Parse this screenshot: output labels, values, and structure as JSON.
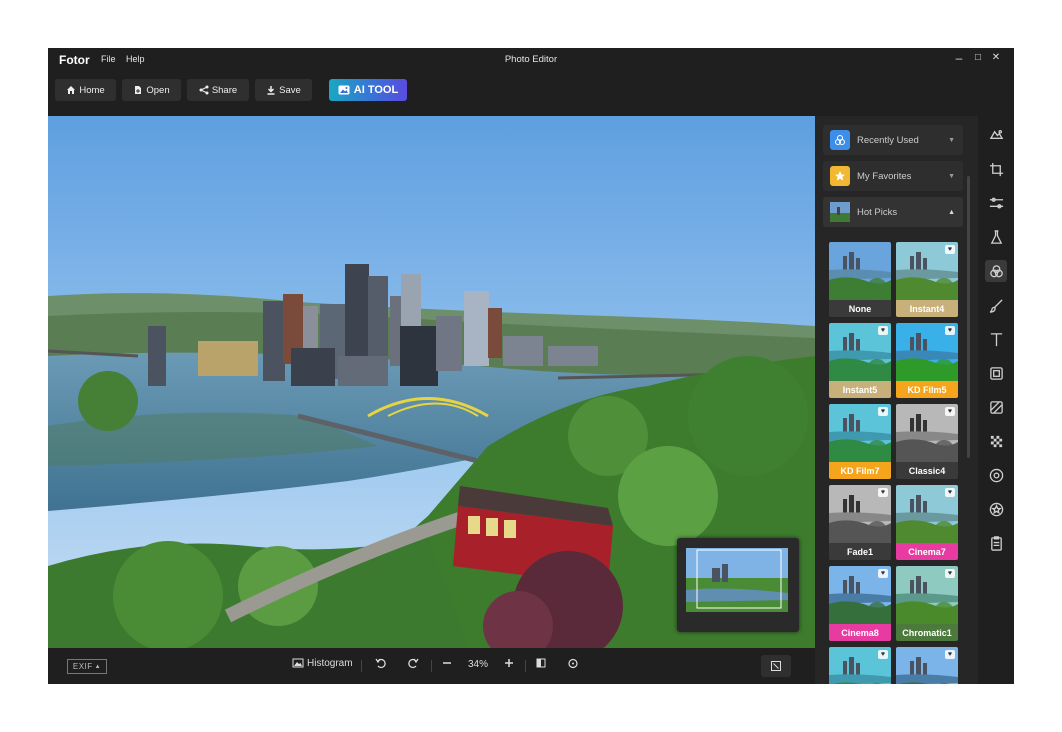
{
  "app": {
    "brand": "Fotor",
    "window_title": "Photo Editor"
  },
  "menu": [
    "File",
    "Help"
  ],
  "window_controls": {
    "minimize": "–",
    "maximize": "□",
    "close": "✕"
  },
  "toolbar": {
    "home_label": "Home",
    "open_label": "Open",
    "share_label": "Share",
    "save_label": "Save",
    "ai_label": "AI TOOL"
  },
  "bottombar": {
    "exif_label": "EXIF",
    "histogram_label": "Histogram",
    "zoom_level": "34%"
  },
  "panel": {
    "sections": [
      {
        "label": "Recently Used",
        "icon": "circles-icon",
        "color": "#3c8ee8",
        "expanded": false
      },
      {
        "label": "My Favorites",
        "icon": "star-icon",
        "color": "#f3b833",
        "expanded": false
      },
      {
        "label": "Hot Picks",
        "icon": "photo-icon",
        "color": "#555555",
        "expanded": true
      }
    ],
    "filters": [
      {
        "label": "None",
        "color": "#3a3a3a",
        "favorite": false
      },
      {
        "label": "Instant4",
        "color": "#c8b07a",
        "favorite": true
      },
      {
        "label": "Instant5",
        "color": "#c8b07a",
        "favorite": true
      },
      {
        "label": "KD Film5",
        "color": "#f4a51c",
        "favorite": true
      },
      {
        "label": "KD Film7",
        "color": "#f4a51c",
        "favorite": true
      },
      {
        "label": "Classic4",
        "color": "#3a3a3a",
        "favorite": true
      },
      {
        "label": "Fade1",
        "color": "#3a3a3a",
        "favorite": true
      },
      {
        "label": "Cinema7",
        "color": "#e83ba2",
        "favorite": true
      },
      {
        "label": "Cinema8",
        "color": "#e83ba2",
        "favorite": true
      },
      {
        "label": "Chromatic1",
        "color": "#4c7a3c",
        "favorite": true
      },
      {
        "label": "",
        "color": "#3a3a3a",
        "favorite": true
      },
      {
        "label": "",
        "color": "#3a3a3a",
        "favorite": true
      }
    ]
  },
  "rail_tools": [
    "ai-cloud-icon",
    "crop-icon",
    "adjust-icon",
    "beauty-icon",
    "filters-icon",
    "brush-icon",
    "text-icon",
    "frame-icon",
    "sticker-icon",
    "mosaic-icon",
    "elements-icon",
    "stamp-icon",
    "clipboard-icon"
  ],
  "rail_active": "filters-icon"
}
